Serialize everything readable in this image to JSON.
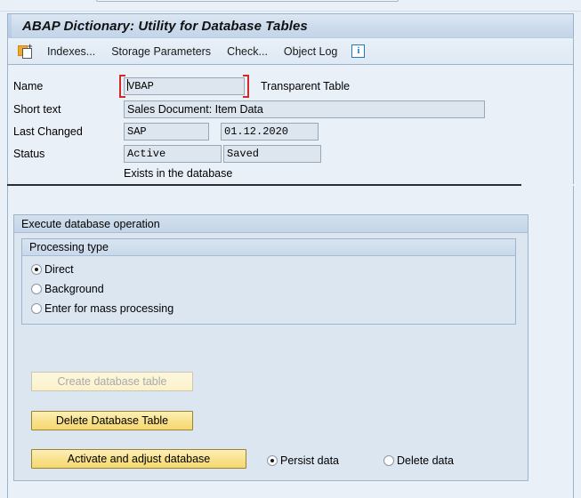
{
  "window": {
    "title": "ABAP Dictionary: Utility for Database Tables"
  },
  "toolbar": {
    "copy_icon": "copy-icon",
    "items": [
      {
        "label": "Indexes..."
      },
      {
        "label": "Storage Parameters"
      },
      {
        "label": "Check..."
      },
      {
        "label": "Object Log"
      }
    ],
    "info_icon_glyph": "i"
  },
  "form": {
    "name": {
      "label": "Name",
      "value": "VBAP",
      "type_text": "Transparent Table",
      "focused": true
    },
    "short_text": {
      "label": "Short text",
      "value": "Sales Document: Item Data"
    },
    "last_changed": {
      "label": "Last Changed",
      "user": "SAP",
      "date": "01.12.2020"
    },
    "status": {
      "label": "Status",
      "activation": "Active",
      "save_state": "Saved",
      "note": "Exists in the database"
    }
  },
  "execute_group": {
    "title": "Execute database operation",
    "processing_type": {
      "title": "Processing type",
      "options": [
        {
          "label": "Direct",
          "selected": true
        },
        {
          "label": "Background",
          "selected": false
        },
        {
          "label": "Enter for mass processing",
          "selected": false
        }
      ]
    },
    "buttons": {
      "create": {
        "label": "Create database table",
        "enabled": false
      },
      "delete": {
        "label": "Delete Database Table",
        "enabled": true
      },
      "activate": {
        "label": "Activate and adjust database",
        "enabled": true
      }
    },
    "data_options": [
      {
        "label": "Persist data",
        "selected": true
      },
      {
        "label": "Delete data",
        "selected": false
      }
    ]
  },
  "colors": {
    "page_background": "#eaf0f7",
    "panel_border": "#9db3cc",
    "button_yellow": "#f8e18a",
    "button_border": "#9a8432",
    "focus_red": "#d02b2b",
    "field_fill": "#dde6ef",
    "group_fill": "#dce6f1",
    "info_blue": "#1e7bbf",
    "icon_orange": "#f5a623"
  }
}
